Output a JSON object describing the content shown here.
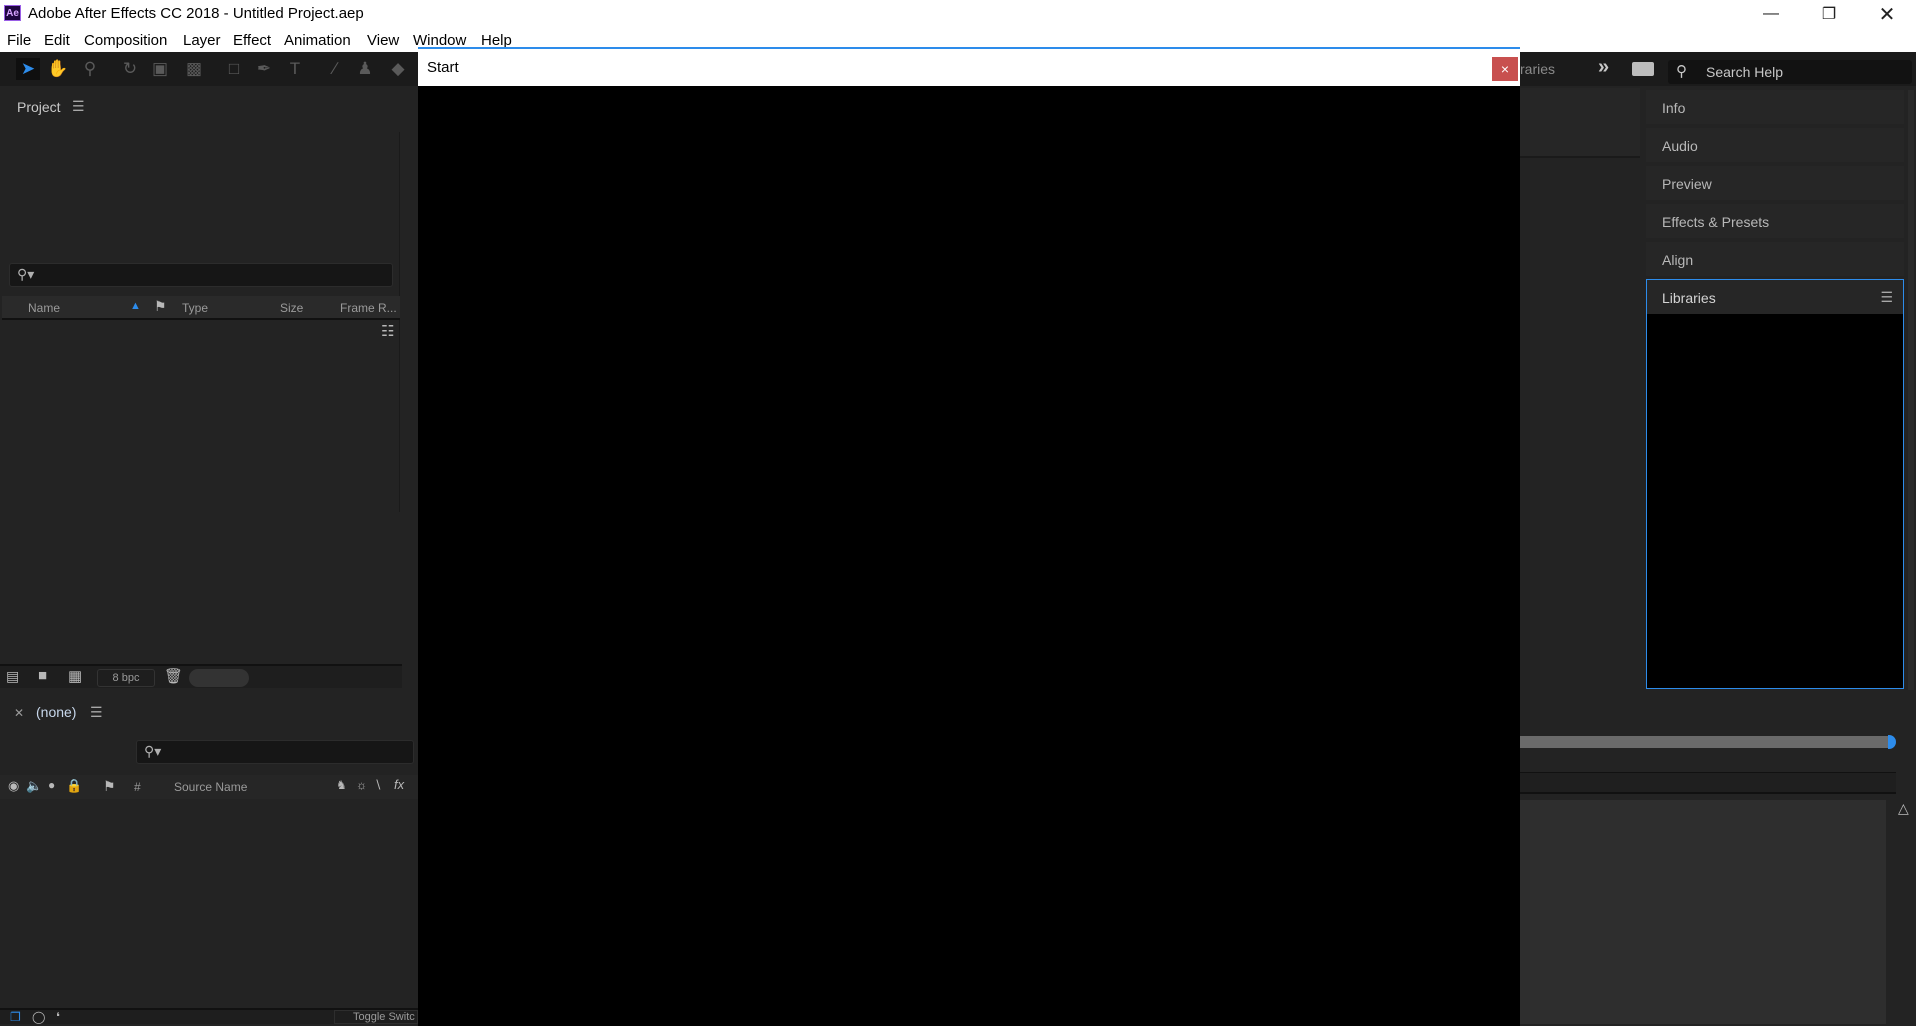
{
  "window": {
    "title": "Adobe After Effects CC 2018 - Untitled Project.aep",
    "app_icon": "Ae",
    "controls": [
      "minimize",
      "restore",
      "close"
    ]
  },
  "menu": [
    "File",
    "Edit",
    "Composition",
    "Layer",
    "Effect",
    "Animation",
    "View",
    "Window",
    "Help"
  ],
  "toolbar": {
    "tools": [
      "selection-tool",
      "hand-tool",
      "zoom-tool",
      "rotation-tool",
      "camera-tool",
      "pan-behind-tool",
      "rectangle-tool",
      "pen-tool",
      "type-tool",
      "brush-tool",
      "clone-stamp-tool",
      "eraser-tool"
    ],
    "workspace_partial": "raries",
    "overflow_glyph": "»",
    "search_help_placeholder": "Search Help"
  },
  "project_panel": {
    "title": "Project",
    "search_placeholder": "",
    "columns": [
      "Name",
      "Type",
      "Size",
      "Frame R..."
    ],
    "bit_depth": "8 bpc"
  },
  "right_panels": {
    "collapsed": [
      "Info",
      "Audio",
      "Preview",
      "Effects & Presets",
      "Align"
    ],
    "active": "Libraries"
  },
  "timeline": {
    "comp_name": "(none)",
    "columns": {
      "number": "#",
      "source_name": "Source Name"
    },
    "toggle_label": "Toggle Switc",
    "work_area_end_pct": 100
  },
  "start_dialog": {
    "title": "Start",
    "close_glyph": "×"
  }
}
